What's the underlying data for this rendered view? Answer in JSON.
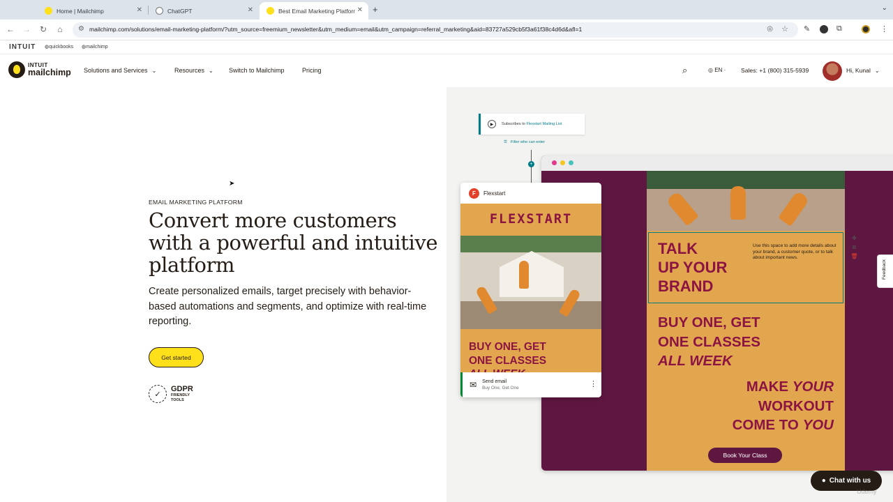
{
  "browser": {
    "tabs": [
      {
        "title": "Home | Mailchimp",
        "active": false
      },
      {
        "title": "ChatGPT",
        "active": false
      },
      {
        "title": "Best Email Marketing Platform",
        "active": true
      }
    ],
    "url": "mailchimp.com/solutions/email-marketing-platform/?utm_source=freemium_newsletter&utm_medium=email&utm_campaign=referral_marketing&aid=83727a529cb5f3a61f38c4d6d&afl=1"
  },
  "intuit_bar": {
    "intuit": "INTUIT",
    "quickbooks": "quickbooks",
    "mailchimp": "mailchimp"
  },
  "header": {
    "logo_top": "INTUIT",
    "logo_bottom": "mailchimp",
    "nav": [
      "Solutions and Services",
      "Resources",
      "Switch to Mailchimp",
      "Pricing"
    ],
    "lang": "EN",
    "sales": "Sales: +1 (800) 315-5939",
    "greeting": "Hi, Kunal"
  },
  "hero": {
    "eyebrow": "EMAIL MARKETING PLATFORM",
    "headline": "Convert more customers with a powerful and intuitive platform",
    "subtext": "Create personalized emails, target precisely with behavior-based automations and segments, and optimize with real-time reporting.",
    "cta": "Get started",
    "gdpr_title": "GDPR",
    "gdpr_sub1": "FRIENDLY",
    "gdpr_sub2": "TOOLS"
  },
  "illustration": {
    "trigger_text": "Subscribes to",
    "trigger_link": "Flexstart Mailing List",
    "filter_text": "Filter who can enter",
    "talk": [
      "TALK",
      "UP YOUR",
      "BRAND"
    ],
    "talk_desc": "Use this space to add more details about your brand, a customer quote, or to talk about important news.",
    "buy": [
      "BUY ONE, GET",
      "ONE CLASSES",
      "ALL WEEK"
    ],
    "make": {
      "l1a": "MAKE ",
      "l1b": "YOUR",
      "l2": "WORKOUT",
      "l3a": "COME TO ",
      "l3b": "YOU"
    },
    "book": "Book Your Class",
    "card_name": "Flexstart",
    "card_brand": "FLEXSTART",
    "card_buy": [
      "BUY ONE, GET",
      "ONE CLASSES",
      "ALL WEEK"
    ],
    "send_title": "Send email",
    "send_sub": "Buy One, Get One"
  },
  "feedback": "Feedback",
  "chat": "Chat with us",
  "watermark": "Udemy",
  "colors": {
    "yellow": "#ffe01b",
    "plum": "#5e1741",
    "mustard": "#e2a64f",
    "crimson": "#8b1442",
    "teal": "#007c89"
  }
}
